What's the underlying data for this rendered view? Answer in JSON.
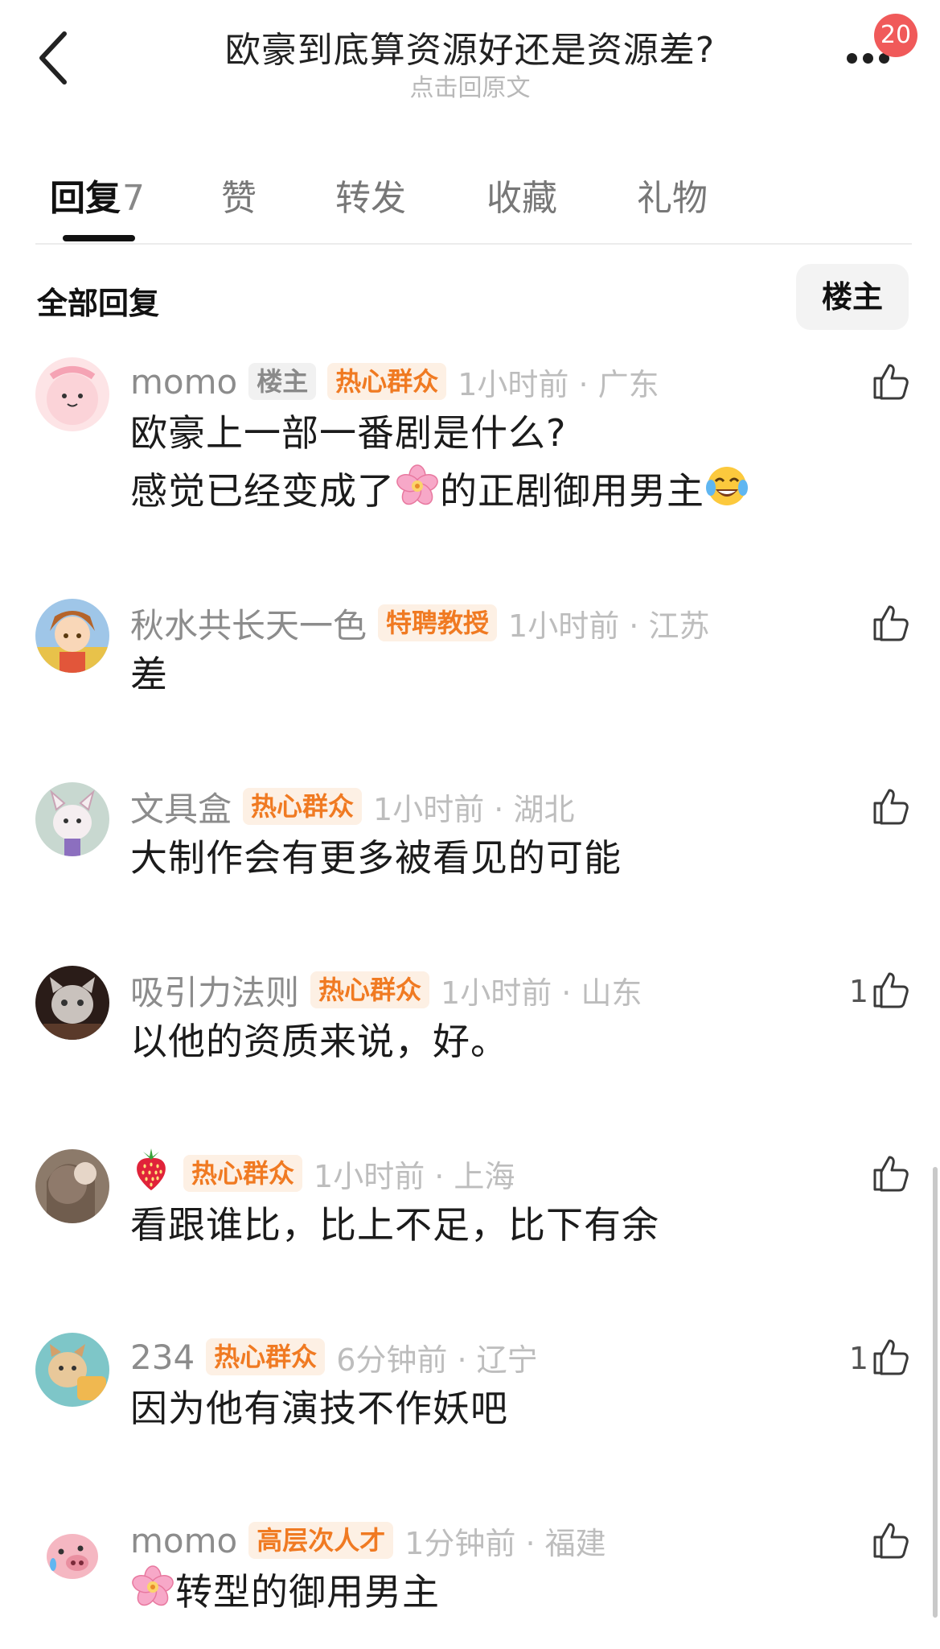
{
  "header": {
    "title": "欧豪到底算资源好还是资源差?",
    "subtitle": "点击回原文",
    "notification_count": "20"
  },
  "tabs": [
    {
      "label": "回复",
      "count": "7",
      "active": true
    },
    {
      "label": "赞"
    },
    {
      "label": "转发"
    },
    {
      "label": "收藏"
    },
    {
      "label": "礼物"
    }
  ],
  "filter": {
    "all_label": "全部回复",
    "owner_label": "楼主"
  },
  "comments": [
    {
      "username": "momo",
      "tags": [
        "楼主",
        "热心群众"
      ],
      "time": "1小时前 · 广东",
      "lines": [
        "欧豪上一部一番剧是什么?",
        "感觉已经变成了[flower]的正剧御用男主[laugh]"
      ],
      "likes": ""
    },
    {
      "username": "秋水共长天一色",
      "tags": [
        "特聘教授"
      ],
      "time": "1小时前 · 江苏",
      "lines": [
        "差"
      ],
      "likes": ""
    },
    {
      "username": "文具盒",
      "tags": [
        "热心群众"
      ],
      "time": "1小时前 · 湖北",
      "lines": [
        "大制作会有更多被看见的可能"
      ],
      "likes": ""
    },
    {
      "username": "吸引力法则",
      "tags": [
        "热心群众"
      ],
      "time": "1小时前 · 山东",
      "lines": [
        "以他的资质来说，好。"
      ],
      "likes": "1"
    },
    {
      "username": "[strawberry]",
      "tags": [
        "热心群众"
      ],
      "time": "1小时前 · 上海",
      "lines": [
        "看跟谁比，比上不足，比下有余"
      ],
      "likes": ""
    },
    {
      "username": "234",
      "tags": [
        "热心群众"
      ],
      "time": "6分钟前 · 辽宁",
      "lines": [
        "因为他有演技不作妖吧"
      ],
      "likes": "1"
    },
    {
      "username": "momo",
      "tags": [
        "高层次人才"
      ],
      "time": "1分钟前 · 福建",
      "lines": [
        "[flower]转型的御用男主"
      ],
      "likes": ""
    }
  ],
  "icons": {
    "back": "back-chevron-icon",
    "more": "more-dots-icon",
    "like": "thumbs-up-icon",
    "flower": "cherry-blossom-emoji",
    "laugh": "laughing-tears-emoji",
    "strawberry": "strawberry-emoji"
  },
  "colors": {
    "accent_orange": "#f07a22",
    "tag_bg_orange": "#fdf0e4",
    "badge_red": "#f05a5a"
  }
}
